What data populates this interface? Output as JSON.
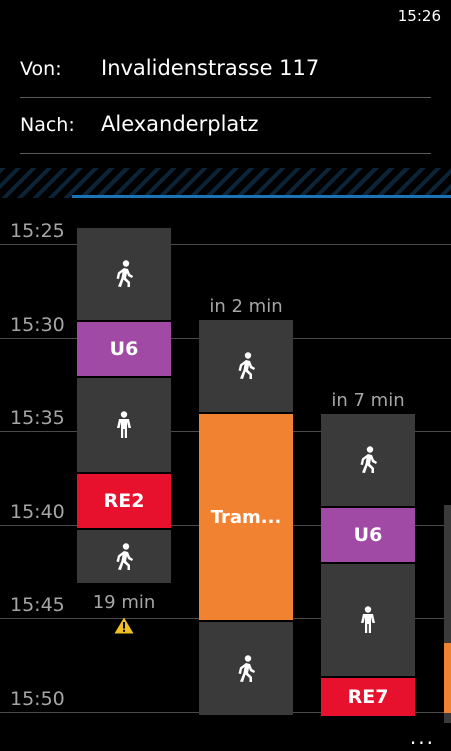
{
  "status": {
    "time": "15:26"
  },
  "form": {
    "from_label": "Von:",
    "from_value": "Invalidenstrasse 117",
    "to_label": "Nach:",
    "to_value": "Alexanderplatz"
  },
  "timeline": {
    "labels": [
      "15:25",
      "15:30",
      "15:35",
      "15:40",
      "15:45",
      "15:50"
    ]
  },
  "routes": [
    {
      "caption_bottom": "19 min",
      "warning": true,
      "segments": [
        {
          "kind": "walk",
          "icon": "walking-person-icon"
        },
        {
          "kind": "ubahn",
          "label": "U6",
          "color": "#a04aa6"
        },
        {
          "kind": "transfer",
          "icon": "standing-person-icon"
        },
        {
          "kind": "regional",
          "label": "RE2",
          "color": "#e8112d"
        },
        {
          "kind": "walk",
          "icon": "walking-person-icon"
        }
      ]
    },
    {
      "caption_top": "in 2 min",
      "segments": [
        {
          "kind": "walk",
          "icon": "walking-person-icon"
        },
        {
          "kind": "tram",
          "label": "Tram...",
          "color": "#f08232"
        },
        {
          "kind": "walk",
          "icon": "walking-person-icon"
        }
      ]
    },
    {
      "caption_top": "in 7 min",
      "segments": [
        {
          "kind": "walk",
          "icon": "walking-person-icon"
        },
        {
          "kind": "ubahn",
          "label": "U6",
          "color": "#a04aa6"
        },
        {
          "kind": "transfer",
          "icon": "standing-person-icon"
        },
        {
          "kind": "regional",
          "label": "RE7",
          "color": "#e8112d"
        }
      ]
    }
  ],
  "appbar": {
    "more": "..."
  }
}
